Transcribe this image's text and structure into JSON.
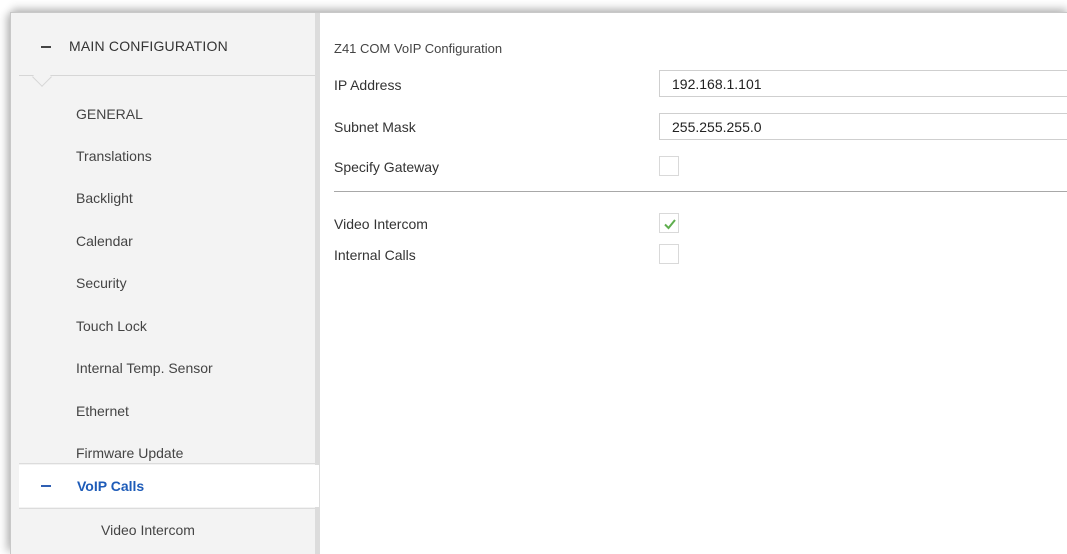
{
  "sidebar": {
    "header": "MAIN CONFIGURATION",
    "items": [
      {
        "label": "GENERAL"
      },
      {
        "label": "Translations"
      },
      {
        "label": "Backlight"
      },
      {
        "label": "Calendar"
      },
      {
        "label": "Security"
      },
      {
        "label": "Touch Lock"
      },
      {
        "label": "Internal Temp. Sensor"
      },
      {
        "label": "Ethernet"
      },
      {
        "label": "Firmware Update"
      }
    ],
    "active_group": "VoIP Calls",
    "sub_items": [
      {
        "label": "Video Intercom"
      }
    ]
  },
  "main": {
    "title": "Z41 COM VoIP Configuration",
    "fields": {
      "ip_address": {
        "label": "IP Address",
        "value": "192.168.1.101"
      },
      "subnet_mask": {
        "label": "Subnet Mask",
        "value": "255.255.255.0"
      }
    },
    "checks": {
      "specify_gateway": {
        "label": "Specify Gateway",
        "checked": false
      },
      "video_intercom": {
        "label": "Video Intercom",
        "checked": true
      },
      "internal_calls": {
        "label": "Internal Calls",
        "checked": false
      }
    }
  },
  "colors": {
    "accent": "#1d5bb8",
    "check": "#5fae4e",
    "sidebar_bg": "#f3f3f3"
  }
}
